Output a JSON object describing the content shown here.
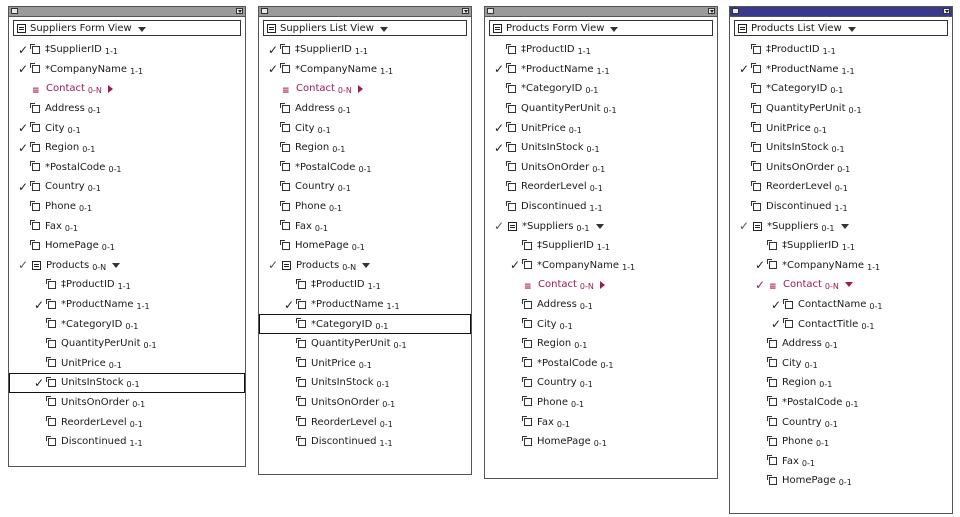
{
  "panels": [
    {
      "id": "suppliers-form",
      "title": "Suppliers Form View",
      "active": false,
      "rows": [
        {
          "level": 0,
          "check": "check",
          "icon": "field",
          "name": "‡SupplierID",
          "card": "1-1"
        },
        {
          "level": 0,
          "check": "check",
          "icon": "field",
          "name": "*CompanyName",
          "card": "1-1"
        },
        {
          "level": 0,
          "check": "",
          "icon": "relation",
          "name": "Contact",
          "card": "0-N",
          "expand": "right",
          "rel": true
        },
        {
          "level": 0,
          "check": "",
          "icon": "field",
          "name": "Address",
          "card": "0-1"
        },
        {
          "level": 0,
          "check": "check",
          "icon": "field",
          "name": "City",
          "card": "0-1"
        },
        {
          "level": 0,
          "check": "check",
          "icon": "field",
          "name": "Region",
          "card": "0-1"
        },
        {
          "level": 0,
          "check": "",
          "icon": "field",
          "name": "*PostalCode",
          "card": "0-1"
        },
        {
          "level": 0,
          "check": "check",
          "icon": "field",
          "name": "Country",
          "card": "0-1"
        },
        {
          "level": 0,
          "check": "",
          "icon": "field",
          "name": "Phone",
          "card": "0-1"
        },
        {
          "level": 0,
          "check": "",
          "icon": "field",
          "name": "Fax",
          "card": "0-1"
        },
        {
          "level": 0,
          "check": "",
          "icon": "field",
          "name": "HomePage",
          "card": "0-1"
        },
        {
          "level": 0,
          "check": "partial",
          "icon": "table",
          "name": "Products",
          "card": "0-N",
          "expand": "down"
        },
        {
          "level": 1,
          "check": "",
          "icon": "field",
          "name": "‡ProductID",
          "card": "1-1"
        },
        {
          "level": 1,
          "check": "check",
          "icon": "field",
          "name": "*ProductName",
          "card": "1-1"
        },
        {
          "level": 1,
          "check": "",
          "icon": "field",
          "name": "*CategoryID",
          "card": "0-1"
        },
        {
          "level": 1,
          "check": "",
          "icon": "field",
          "name": "QuantityPerUnit",
          "card": "0-1"
        },
        {
          "level": 1,
          "check": "",
          "icon": "field",
          "name": "UnitPrice",
          "card": "0-1"
        },
        {
          "level": 1,
          "check": "check",
          "icon": "field",
          "name": "UnitsInStock",
          "card": "0-1",
          "selected": true
        },
        {
          "level": 1,
          "check": "",
          "icon": "field",
          "name": "UnitsOnOrder",
          "card": "0-1"
        },
        {
          "level": 1,
          "check": "",
          "icon": "field",
          "name": "ReorderLevel",
          "card": "0-1"
        },
        {
          "level": 1,
          "check": "",
          "icon": "field",
          "name": "Discontinued",
          "card": "1-1"
        }
      ]
    },
    {
      "id": "suppliers-list",
      "title": "Suppliers List View",
      "active": false,
      "rows": [
        {
          "level": 0,
          "check": "check",
          "icon": "field",
          "name": "‡SupplierID",
          "card": "1-1"
        },
        {
          "level": 0,
          "check": "check",
          "icon": "field",
          "name": "*CompanyName",
          "card": "1-1"
        },
        {
          "level": 0,
          "check": "",
          "icon": "relation",
          "name": "Contact",
          "card": "0-N",
          "expand": "right",
          "rel": true
        },
        {
          "level": 0,
          "check": "",
          "icon": "field",
          "name": "Address",
          "card": "0-1"
        },
        {
          "level": 0,
          "check": "",
          "icon": "field",
          "name": "City",
          "card": "0-1"
        },
        {
          "level": 0,
          "check": "",
          "icon": "field",
          "name": "Region",
          "card": "0-1"
        },
        {
          "level": 0,
          "check": "",
          "icon": "field",
          "name": "*PostalCode",
          "card": "0-1"
        },
        {
          "level": 0,
          "check": "",
          "icon": "field",
          "name": "Country",
          "card": "0-1"
        },
        {
          "level": 0,
          "check": "",
          "icon": "field",
          "name": "Phone",
          "card": "0-1"
        },
        {
          "level": 0,
          "check": "",
          "icon": "field",
          "name": "Fax",
          "card": "0-1"
        },
        {
          "level": 0,
          "check": "",
          "icon": "field",
          "name": "HomePage",
          "card": "0-1"
        },
        {
          "level": 0,
          "check": "partial",
          "icon": "table",
          "name": "Products",
          "card": "0-N",
          "expand": "down"
        },
        {
          "level": 1,
          "check": "",
          "icon": "field",
          "name": "‡ProductID",
          "card": "1-1"
        },
        {
          "level": 1,
          "check": "check",
          "icon": "field",
          "name": "*ProductName",
          "card": "1-1"
        },
        {
          "level": 1,
          "check": "",
          "icon": "field",
          "name": "*CategoryID",
          "card": "0-1",
          "selected": true
        },
        {
          "level": 1,
          "check": "",
          "icon": "field",
          "name": "QuantityPerUnit",
          "card": "0-1"
        },
        {
          "level": 1,
          "check": "",
          "icon": "field",
          "name": "UnitPrice",
          "card": "0-1"
        },
        {
          "level": 1,
          "check": "",
          "icon": "field",
          "name": "UnitsInStock",
          "card": "0-1"
        },
        {
          "level": 1,
          "check": "",
          "icon": "field",
          "name": "UnitsOnOrder",
          "card": "0-1"
        },
        {
          "level": 1,
          "check": "",
          "icon": "field",
          "name": "ReorderLevel",
          "card": "0-1"
        },
        {
          "level": 1,
          "check": "",
          "icon": "field",
          "name": "Discontinued",
          "card": "1-1"
        }
      ]
    },
    {
      "id": "products-form",
      "title": "Products Form View",
      "active": false,
      "rows": [
        {
          "level": 0,
          "check": "",
          "icon": "field",
          "name": "‡ProductID",
          "card": "1-1"
        },
        {
          "level": 0,
          "check": "check",
          "icon": "field",
          "name": "*ProductName",
          "card": "1-1"
        },
        {
          "level": 0,
          "check": "",
          "icon": "field",
          "name": "*CategoryID",
          "card": "0-1"
        },
        {
          "level": 0,
          "check": "",
          "icon": "field",
          "name": "QuantityPerUnit",
          "card": "0-1"
        },
        {
          "level": 0,
          "check": "check",
          "icon": "field",
          "name": "UnitPrice",
          "card": "0-1"
        },
        {
          "level": 0,
          "check": "check",
          "icon": "field",
          "name": "UnitsInStock",
          "card": "0-1"
        },
        {
          "level": 0,
          "check": "",
          "icon": "field",
          "name": "UnitsOnOrder",
          "card": "0-1"
        },
        {
          "level": 0,
          "check": "",
          "icon": "field",
          "name": "ReorderLevel",
          "card": "0-1"
        },
        {
          "level": 0,
          "check": "",
          "icon": "field",
          "name": "Discontinued",
          "card": "1-1"
        },
        {
          "level": 0,
          "check": "partial",
          "icon": "table",
          "name": "*Suppliers",
          "card": "0-1",
          "expand": "down"
        },
        {
          "level": 1,
          "check": "",
          "icon": "field",
          "name": "‡SupplierID",
          "card": "1-1"
        },
        {
          "level": 1,
          "check": "check",
          "icon": "field",
          "name": "*CompanyName",
          "card": "1-1"
        },
        {
          "level": 1,
          "check": "",
          "icon": "relation",
          "name": "Contact",
          "card": "0-N",
          "expand": "right",
          "rel": true
        },
        {
          "level": 1,
          "check": "",
          "icon": "field",
          "name": "Address",
          "card": "0-1"
        },
        {
          "level": 1,
          "check": "",
          "icon": "field",
          "name": "City",
          "card": "0-1"
        },
        {
          "level": 1,
          "check": "",
          "icon": "field",
          "name": "Region",
          "card": "0-1"
        },
        {
          "level": 1,
          "check": "",
          "icon": "field",
          "name": "*PostalCode",
          "card": "0-1"
        },
        {
          "level": 1,
          "check": "",
          "icon": "field",
          "name": "Country",
          "card": "0-1"
        },
        {
          "level": 1,
          "check": "",
          "icon": "field",
          "name": "Phone",
          "card": "0-1"
        },
        {
          "level": 1,
          "check": "",
          "icon": "field",
          "name": "Fax",
          "card": "0-1"
        },
        {
          "level": 1,
          "check": "",
          "icon": "field",
          "name": "HomePage",
          "card": "0-1"
        }
      ]
    },
    {
      "id": "products-list",
      "title": "Products List View",
      "active": true,
      "rows": [
        {
          "level": 0,
          "check": "",
          "icon": "field",
          "name": "‡ProductID",
          "card": "1-1"
        },
        {
          "level": 0,
          "check": "check",
          "icon": "field",
          "name": "*ProductName",
          "card": "1-1"
        },
        {
          "level": 0,
          "check": "",
          "icon": "field",
          "name": "*CategoryID",
          "card": "0-1"
        },
        {
          "level": 0,
          "check": "",
          "icon": "field",
          "name": "QuantityPerUnit",
          "card": "0-1"
        },
        {
          "level": 0,
          "check": "",
          "icon": "field",
          "name": "UnitPrice",
          "card": "0-1"
        },
        {
          "level": 0,
          "check": "",
          "icon": "field",
          "name": "UnitsInStock",
          "card": "0-1"
        },
        {
          "level": 0,
          "check": "",
          "icon": "field",
          "name": "UnitsOnOrder",
          "card": "0-1"
        },
        {
          "level": 0,
          "check": "",
          "icon": "field",
          "name": "ReorderLevel",
          "card": "0-1"
        },
        {
          "level": 0,
          "check": "",
          "icon": "field",
          "name": "Discontinued",
          "card": "1-1"
        },
        {
          "level": 0,
          "check": "partial",
          "icon": "table",
          "name": "*Suppliers",
          "card": "0-1",
          "expand": "down"
        },
        {
          "level": 1,
          "check": "",
          "icon": "field",
          "name": "‡SupplierID",
          "card": "1-1"
        },
        {
          "level": 1,
          "check": "check",
          "icon": "field",
          "name": "*CompanyName",
          "card": "1-1"
        },
        {
          "level": 1,
          "check": "check-red",
          "icon": "relation",
          "name": "Contact",
          "card": "0-N",
          "expand": "down",
          "rel": true
        },
        {
          "level": 2,
          "check": "check",
          "icon": "field",
          "name": "ContactName",
          "card": "0-1"
        },
        {
          "level": 2,
          "check": "check",
          "icon": "field",
          "name": "ContactTitle",
          "card": "0-1"
        },
        {
          "level": 1,
          "check": "",
          "icon": "field",
          "name": "Address",
          "card": "0-1"
        },
        {
          "level": 1,
          "check": "",
          "icon": "field",
          "name": "City",
          "card": "0-1"
        },
        {
          "level": 1,
          "check": "",
          "icon": "field",
          "name": "Region",
          "card": "0-1"
        },
        {
          "level": 1,
          "check": "",
          "icon": "field",
          "name": "*PostalCode",
          "card": "0-1"
        },
        {
          "level": 1,
          "check": "",
          "icon": "field",
          "name": "Country",
          "card": "0-1"
        },
        {
          "level": 1,
          "check": "",
          "icon": "field",
          "name": "Phone",
          "card": "0-1"
        },
        {
          "level": 1,
          "check": "",
          "icon": "field",
          "name": "Fax",
          "card": "0-1"
        },
        {
          "level": 1,
          "check": "",
          "icon": "field",
          "name": "HomePage",
          "card": "0-1"
        }
      ]
    }
  ],
  "colors": {
    "relation": "#9b1b54",
    "active_titlebar": "#3a3a8c",
    "inactive_titlebar": "#9a9a9a"
  }
}
